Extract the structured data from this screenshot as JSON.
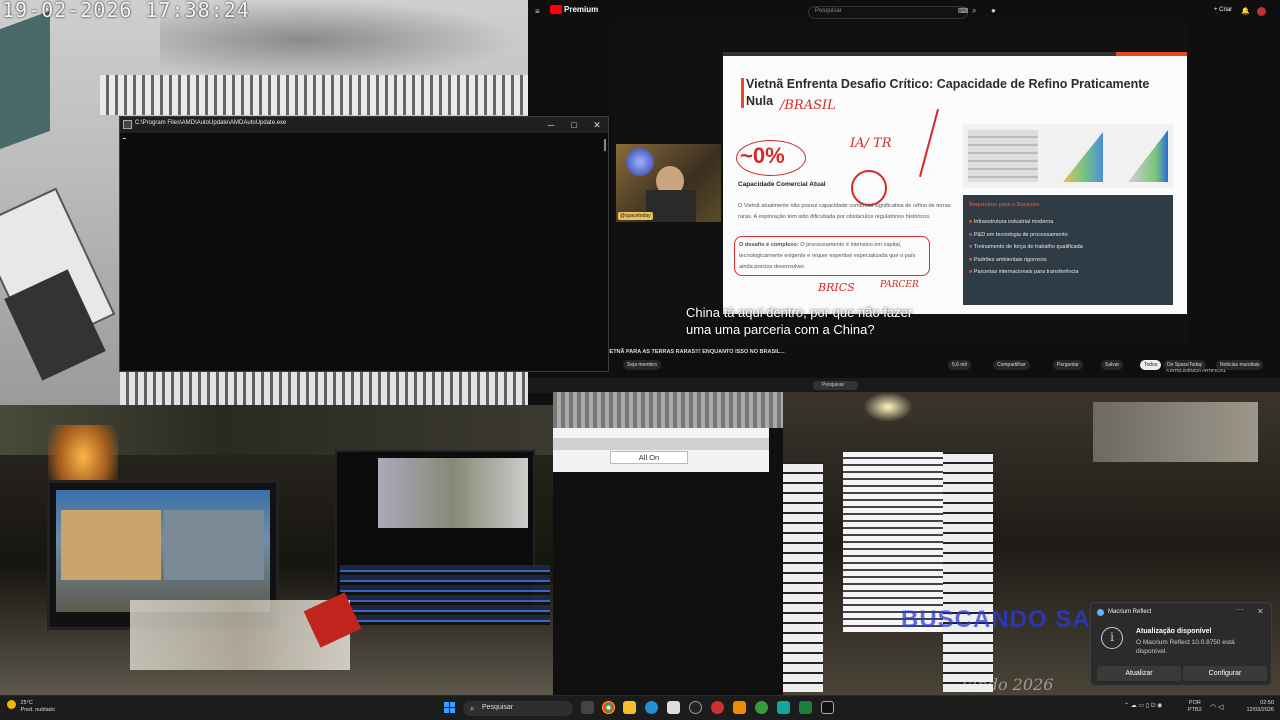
{
  "cctv_top": {
    "timestamp": "19-02-2026  17:38:24"
  },
  "youtube": {
    "logo": "Premium",
    "search_placeholder": "Pesquisar",
    "create_label": "+ Criar",
    "slide": {
      "title": "Vietnã Enfrenta Desafio Crítico: Capacidade de Refino Praticamente Nula",
      "title_underlined": "Capacidade de Refino Praticamente",
      "handwritten_brasil": "/BRASIL",
      "handwritten_ia_tr": "IA/ TR",
      "handwritten_parcer": "PARCER",
      "handwritten_brics": "BRICS",
      "percent": "~0%",
      "subtitle": "Capacidade Comercial Atual",
      "body": "O Vietnã atualmente não possui capacidade comercial significativa de refino de terras raras. A exploração tem sido dificultada por obstáculos regulatórios históricos.",
      "challenge_label": "O desafio é complexo:",
      "challenge_text": " O processamento é intensivo em capital, tecnologicamente exigente e requer expertise especializada que o país ainda precisa desenvolver.",
      "panel_title": "Requisitos para o Sucesso",
      "panel_items": [
        "Infraestrutura industrial moderna",
        "P&D em tecnologia de processamento",
        "Treinamento de força de trabalho qualificada",
        "Padrões ambientais rigorosos",
        "Parcerias internacionais para transferência"
      ]
    },
    "webcam_tag": "@spacetoday",
    "caption_line1": "China tá aqui dentro, por que não fazer",
    "caption_line2": "uma uma parceria com a China?",
    "marquee": "IETNÃ PARA AS TERRAS RARAS!!! ENQUANTO ISSO NO BRASIL...",
    "subscribe_label": "Seja membro",
    "actions": [
      "5,6 mil",
      "Compartilhar",
      "Perguntar",
      "Salvar"
    ],
    "chips": [
      "Todos",
      "De SpaceToday",
      "Notícias mundiais"
    ],
    "side_text": "A INTELIGÊNCIA ARTIFICIAL"
  },
  "amd_window": {
    "title": "C:\\Program Files\\AMD\\AutoUpdate\\AMDAutoUpdate.exe",
    "minimize": "─",
    "maximize": "□",
    "close": "✕"
  },
  "mid_strip": {
    "search_label": "Pesquisar"
  },
  "panel_mid": {
    "all_on_label": "All On"
  },
  "cam_br": {
    "overlay_text": "BUSCANDO SAI",
    "overlay_text2": "Vindo 2026"
  },
  "toast": {
    "app": "Macrium Reflect",
    "title": "Atualização disponível",
    "message": "O Macrium Reflect 10.0.8750 está disponível.",
    "button_update": "Atualizar",
    "button_configure": "Configurar",
    "close": "✕",
    "more": "···"
  },
  "taskbar": {
    "weather_temp": "25°C",
    "weather_desc": "Pred. nublado",
    "search_label": "Pesquisar",
    "lang_top": "POR",
    "lang_bottom": "PTB2",
    "time": "02:50",
    "date": "12/03/2026"
  },
  "colors": {
    "accent_red": "#d62828",
    "slide_orange": "#e34c26",
    "taskbar_bg": "#1c1c1c"
  }
}
